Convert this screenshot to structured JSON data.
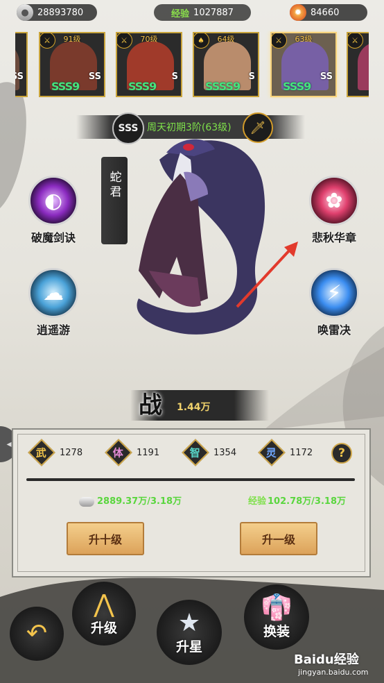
{
  "resources": {
    "silver": "28893780",
    "exp_label": "经验",
    "exp": "1027887",
    "fire": "84660"
  },
  "roster": [
    {
      "level": "",
      "grade": "SS",
      "stars": "",
      "portrait_color": "#6b4a3c"
    },
    {
      "level": "91级",
      "grade": "SS",
      "stars": "SSS9",
      "portrait_color": "#7a3a2c"
    },
    {
      "level": "70级",
      "grade": "S",
      "stars": "SSS9",
      "portrait_color": "#a03a2a"
    },
    {
      "level": "64级",
      "grade": "S",
      "stars": "SSSS9",
      "portrait_color": "#b98c6c"
    },
    {
      "level": "63级",
      "grade": "SS",
      "stars": "SSS9",
      "portrait_color": "#7760a5",
      "selected": true
    },
    {
      "level": "",
      "grade": "",
      "stars": "",
      "portrait_color": "#9a3b5c"
    }
  ],
  "hero": {
    "grade_badge": "SSS",
    "rank": "周天初期3阶(63级)",
    "name": "蛇君",
    "power_glyph": "战",
    "power": "1.44万"
  },
  "skills": {
    "left_top": "破魔剑诀",
    "left_bottom": "逍遥游",
    "right_top": "悲秋华章",
    "right_bottom": "唤雷决"
  },
  "stats": [
    {
      "glyph": "武",
      "value": "1278",
      "color": "#f0c34a"
    },
    {
      "glyph": "体",
      "value": "1191",
      "color": "#e58bd6"
    },
    {
      "glyph": "智",
      "value": "1354",
      "color": "#58d6c8"
    },
    {
      "glyph": "灵",
      "value": "1172",
      "color": "#6ea6ff"
    }
  ],
  "help": "?",
  "costs": {
    "silver": "2889.37万/3.18万",
    "exp_label": "经验",
    "exp": "102.78万/3.18万"
  },
  "buttons": {
    "up_ten": "升十级",
    "up_one": "升一级"
  },
  "nav": {
    "back": "↶",
    "upgrade": "升级",
    "star": "升星",
    "equip": "换装"
  },
  "watermark": {
    "brand": "Baidu经验",
    "url": "jingyan.baidu.com"
  }
}
